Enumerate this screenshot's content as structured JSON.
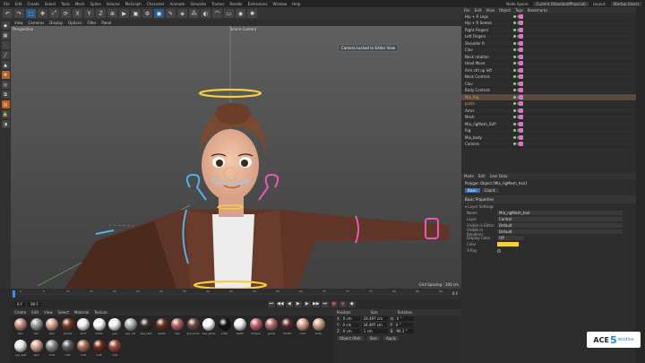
{
  "menubar": {
    "items": [
      "File",
      "Edit",
      "Create",
      "Select",
      "Tools",
      "Mesh",
      "Spline",
      "Volume",
      "MoGraph",
      "Character",
      "Animate",
      "Simulate",
      "Tracker",
      "Render",
      "Extensions",
      "Window",
      "Help"
    ],
    "right_items": [
      "Node Space:",
      "Current (Standard/Physical)",
      "Layout:"
    ],
    "layout_value": "Startup (User)"
  },
  "viewport": {
    "menu": [
      "View",
      "Cameras",
      "Display",
      "Options",
      "Filter",
      "Panel"
    ],
    "label": "Perspective",
    "camera": "Scene Camera",
    "tooltip": "Camera Locked to Editor View",
    "grid_spacing": "Grid Spacing : 100 cm"
  },
  "timeline": {
    "ticks": [
      "0",
      "5",
      "10",
      "15",
      "20",
      "25",
      "30",
      "35",
      "40",
      "45",
      "50",
      "55",
      "60",
      "65",
      "70",
      "75",
      "80",
      "85",
      "90"
    ],
    "start": "0 F",
    "end": "90 F",
    "current": "0 F"
  },
  "materials": {
    "menu": [
      "Create",
      "Edit",
      "View",
      "Select",
      "Material",
      "Texture"
    ],
    "items": [
      {
        "label": "skin",
        "color": "#c98b7c"
      },
      {
        "label": "hair",
        "color": "#9a9a9a"
      },
      {
        "label": "skin",
        "color": "#d9a08c"
      },
      {
        "label": "jacket",
        "color": "#7a3a22"
      },
      {
        "label": "shirt",
        "color": "#f0f0f0"
      },
      {
        "label": "white",
        "color": "#ffffff"
      },
      {
        "label": "eye",
        "color": "#f5f5f5"
      },
      {
        "label": "eye_iris",
        "color": "#b0b0b0"
      },
      {
        "label": "eye_lash",
        "color": "#3a2a22"
      },
      {
        "label": "pants",
        "color": "#6b3020"
      },
      {
        "label": "lips",
        "color": "#b56060"
      },
      {
        "label": "eye_brow",
        "color": "#6a4a3a"
      },
      {
        "label": "eye_gloss",
        "color": "#ffffff"
      },
      {
        "label": "pupil",
        "color": "#111111"
      },
      {
        "label": "teeth",
        "color": "#eeeeee"
      },
      {
        "label": "tongue",
        "color": "#c0606a"
      },
      {
        "label": "gums",
        "color": "#b06a6a"
      },
      {
        "label": "mouth",
        "color": "#5a2a2a"
      },
      {
        "label": "nails",
        "color": "#d9a08c"
      },
      {
        "label": "body",
        "color": "#cfa08a"
      },
      {
        "label": "eye_wet",
        "color": "#e8e8e8"
      },
      {
        "label": "skin",
        "color": "#d9a08c"
      },
      {
        "label": "mat",
        "color": "#8a8a8a"
      },
      {
        "label": "mat",
        "color": "#5a5a5a"
      },
      {
        "label": "mat",
        "color": "#a07050"
      },
      {
        "label": "mat",
        "color": "#702a1a"
      },
      {
        "label": "mat",
        "color": "#9a4a3a"
      }
    ]
  },
  "coords": {
    "headers": [
      "Position",
      "Size",
      "Rotation"
    ],
    "rows": [
      {
        "axis": "X",
        "pos": "0 cm",
        "size": "24.497 cm",
        "rot_axis": "H",
        "rot": "0 °"
      },
      {
        "axis": "Y",
        "pos": "0 cm",
        "size": "24.497 cm",
        "rot_axis": "P",
        "rot": "0 °"
      },
      {
        "axis": "Z",
        "pos": "0 cm",
        "size": "1 cm",
        "rot_axis": "B",
        "rot": "90.1 °"
      }
    ],
    "mode": "Object (Rel)",
    "size_mode": "Size",
    "apply": "Apply"
  },
  "objects": {
    "menu": [
      "File",
      "Edit",
      "View",
      "Object",
      "Tags",
      "Bookmarks"
    ],
    "rows": [
      {
        "name": "Hip + R Legs",
        "orange": false
      },
      {
        "name": "Hip + R Somes",
        "orange": false
      },
      {
        "name": "Right Fingers",
        "orange": false
      },
      {
        "name": "Left Fingers",
        "orange": false
      },
      {
        "name": "Shoulder R",
        "orange": false
      },
      {
        "name": "Clav",
        "orange": false
      },
      {
        "name": "Neck rotation",
        "orange": false
      },
      {
        "name": "Head Move",
        "orange": false
      },
      {
        "name": "Arm ctrl up left",
        "orange": false
      },
      {
        "name": "Neck Controls",
        "orange": false
      },
      {
        "name": "Clav",
        "orange": false
      },
      {
        "name": "Body Controls",
        "orange": false
      },
      {
        "name": "Mia_Rig",
        "orange": true,
        "selected": true
      },
      {
        "name": "Joints",
        "orange": true
      },
      {
        "name": "Arms",
        "orange": false
      },
      {
        "name": "Mesh",
        "orange": false
      },
      {
        "name": "Mia_rigMesh_SUP",
        "orange": false
      },
      {
        "name": "Rig",
        "orange": false
      },
      {
        "name": "Mia_body",
        "orange": false
      },
      {
        "name": "Camera",
        "orange": false
      }
    ]
  },
  "attributes": {
    "tabs": [
      "Mode",
      "Edit",
      "User Data"
    ],
    "title": "Polygon Object [Mia_rigMesh_hair]",
    "buttons": [
      "Basic",
      "Coord."
    ],
    "section": "Basic Properties",
    "subsection": "▾ Layer Settings",
    "props": [
      {
        "k": "Name",
        "v": "Mia_rigMesh_hair"
      },
      {
        "k": "Layer",
        "v": "Control"
      },
      {
        "k": "Visible in Editor",
        "v": "Default"
      },
      {
        "k": "Visible in Renderer",
        "v": "Default"
      },
      {
        "k": "Display Color",
        "v": "Off"
      },
      {
        "k": "Color",
        "v": ""
      },
      {
        "k": "X-Ray",
        "v": ""
      }
    ],
    "color_value": "#f5d03a"
  },
  "logo": {
    "text": "ACE",
    "num": "5",
    "sub": "studios"
  }
}
